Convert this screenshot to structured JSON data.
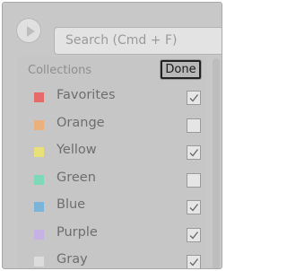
{
  "search": {
    "placeholder": "Search (Cmd + F)"
  },
  "collections": {
    "header": "Collections",
    "done_label": "Done",
    "items": [
      {
        "label": "Favorites",
        "color": "#e66a6a",
        "checked": true
      },
      {
        "label": "Orange",
        "color": "#ecb07c",
        "checked": false
      },
      {
        "label": "Yellow",
        "color": "#e9e07a",
        "checked": true
      },
      {
        "label": "Green",
        "color": "#7ed9b8",
        "checked": false
      },
      {
        "label": "Blue",
        "color": "#7bb4d9",
        "checked": true
      },
      {
        "label": "Purple",
        "color": "#c6b3e3",
        "checked": true
      },
      {
        "label": "Gray",
        "color": "#dcdcdc",
        "checked": true
      }
    ]
  }
}
